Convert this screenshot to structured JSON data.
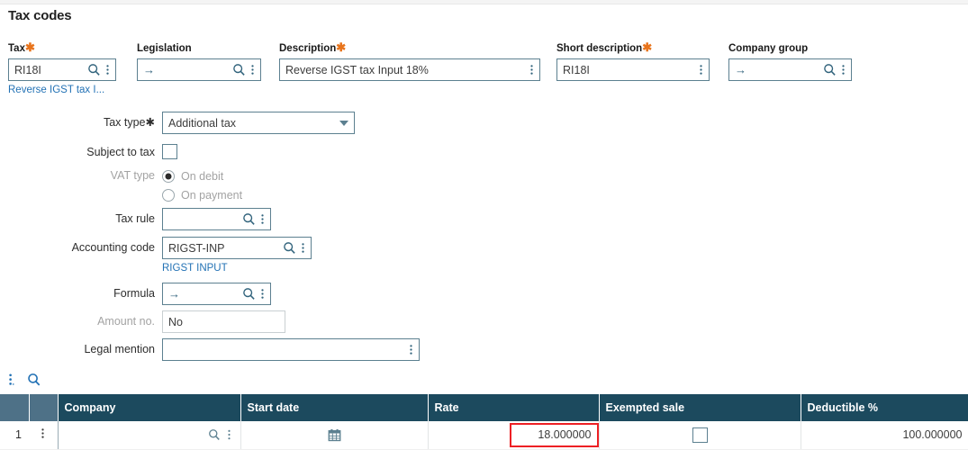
{
  "page": {
    "title": "Tax codes"
  },
  "header_fields": [
    {
      "label": "Tax",
      "required": true,
      "value": "RI18I",
      "placeholder": "",
      "icons": [
        "search-icon",
        "kebab-icon"
      ],
      "helper": "Reverse IGST tax I..."
    },
    {
      "label": "Legislation",
      "required": false,
      "value": "",
      "arrow": "→",
      "icons": [
        "search-icon",
        "kebab-icon"
      ],
      "helper": ""
    },
    {
      "label": "Description",
      "required": true,
      "value": "Reverse IGST tax Input 18%",
      "icons": [
        "kebab-icon"
      ],
      "helper": ""
    },
    {
      "label": "Short description",
      "required": true,
      "value": "RI18I",
      "icons": [
        "kebab-icon"
      ],
      "helper": ""
    },
    {
      "label": "Company group",
      "required": false,
      "value": "",
      "arrow": "→",
      "icons": [
        "search-icon",
        "kebab-icon"
      ],
      "helper": ""
    }
  ],
  "form": {
    "tax_type": {
      "label": "Tax type",
      "required": true,
      "value": "Additional tax",
      "options": [
        "Additional tax"
      ]
    },
    "subject_to_tax": {
      "label": "Subject to tax",
      "checked": false
    },
    "vat_type": {
      "label": "VAT type",
      "disabled": true,
      "selected": "On debit",
      "options": [
        "On debit",
        "On payment"
      ]
    },
    "tax_rule": {
      "label": "Tax rule",
      "value": "",
      "icons": [
        "search-icon",
        "kebab-icon"
      ]
    },
    "accounting_code": {
      "label": "Accounting code",
      "value": "RIGST-INP",
      "icons": [
        "search-icon",
        "kebab-icon"
      ],
      "helper": "RIGST INPUT"
    },
    "formula": {
      "label": "Formula",
      "value": "",
      "arrow": "→",
      "icons": [
        "search-icon",
        "kebab-icon"
      ]
    },
    "amount_no": {
      "label": "Amount no.",
      "disabled": true,
      "value": "No"
    },
    "legal_mention": {
      "label": "Legal mention",
      "value": "",
      "icons": [
        "kebab-icon"
      ]
    }
  },
  "grid_toolbar": {
    "actions_label": "kebab-icon",
    "search_label": "search-icon"
  },
  "grid": {
    "columns": [
      "",
      "",
      "Company",
      "Start date",
      "Rate",
      "Exempted sale",
      "Deductible %"
    ],
    "rows": [
      {
        "number": "1",
        "company": "",
        "start_date": "",
        "rate": "18.000000",
        "rate_highlighted": true,
        "exempted_sale": false,
        "deductible_pct": "100.000000"
      }
    ]
  },
  "colors": {
    "accent_link": "#2372b5",
    "required_marker": "#e8741c",
    "grid_header": "#1c4a5e",
    "grid_corner": "#4e7187",
    "field_border": "#5c8090",
    "highlight_border": "#ed2024"
  }
}
